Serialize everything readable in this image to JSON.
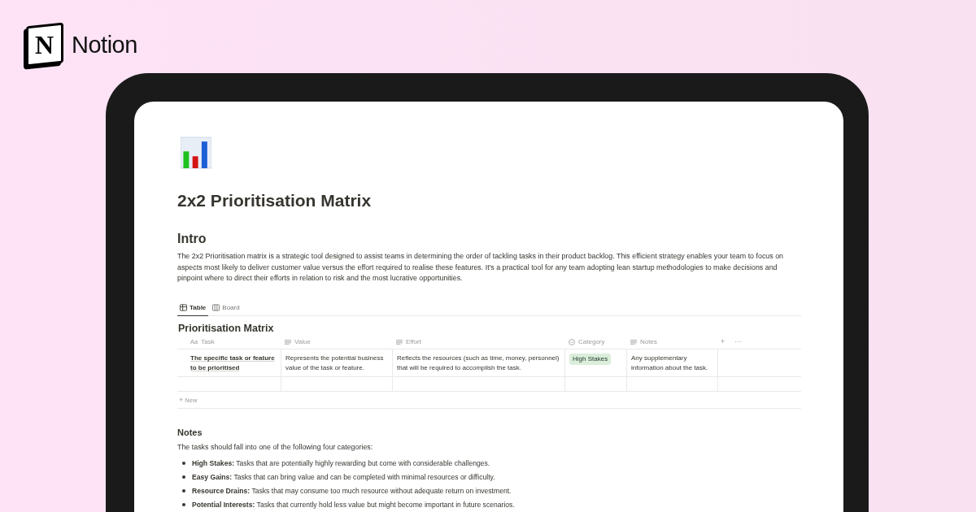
{
  "brand": {
    "name": "Notion",
    "logo_letter": "N"
  },
  "page": {
    "title": "2x2 Prioritisation Matrix",
    "intro": {
      "heading": "Intro",
      "text": "The 2x2 Prioritisation matrix is a strategic tool designed to assist teams in determining the order of tackling tasks in their product backlog. This efficient strategy enables your team to focus on aspects most likely to deliver customer value versus the effort required to realise these features. It's a practical tool for any team adopting lean startup methodologies to make decisions and pinpoint where to direct their efforts in relation to risk and the most lucrative opportunities."
    },
    "views": [
      {
        "label": "Table",
        "kind": "table",
        "selected": true
      },
      {
        "label": "Board",
        "kind": "board",
        "selected": false
      }
    ],
    "database": {
      "title": "Prioritisation Matrix",
      "columns": [
        {
          "label": "Task",
          "kind": "title",
          "icon": "Aa"
        },
        {
          "label": "Value",
          "kind": "text"
        },
        {
          "label": "Effort",
          "kind": "text"
        },
        {
          "label": "Category",
          "kind": "select"
        },
        {
          "label": "Notes",
          "kind": "text"
        }
      ],
      "add_column": "+",
      "more": "···",
      "rows": [
        {
          "task": "The specific task or feature to be prioritised",
          "value": "Represents the potential business value of the task or feature.",
          "effort": "Reflects the resources (such as time, money, personnel) that will be required to accomplish the task.",
          "category": {
            "label": "High Stakes",
            "color": "#dbeddb"
          },
          "notes": "Any supplementary information about the task."
        }
      ],
      "new_row": {
        "icon": "+",
        "label": "New"
      }
    },
    "notes": {
      "heading": "Notes",
      "text": "The tasks should fall into one of the following four categories:",
      "bullets": [
        "**High Stakes:** Tasks that are potentially highly rewarding but come with considerable challenges.",
        "**Easy Gains:** Tasks that can bring value and can be completed with minimal resources or difficulty.",
        "**Resource Drains:** Tasks that may consume too much resource without adequate return on investment.",
        "**Potential Interests:** Tasks that currently hold less value but might become important in future scenarios."
      ]
    }
  }
}
